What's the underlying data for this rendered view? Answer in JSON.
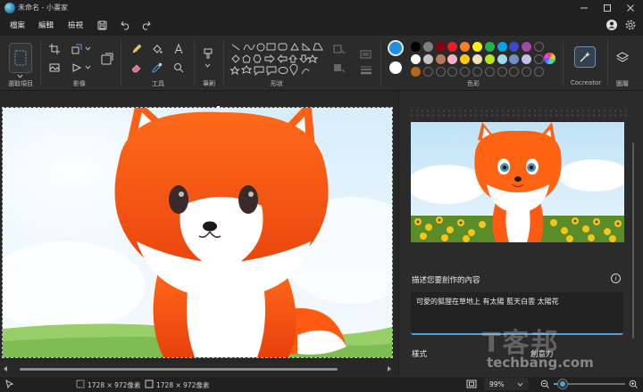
{
  "window": {
    "title": "未命名 - 小畫家",
    "minimize_icon": "minimize-icon",
    "maximize_icon": "maximize-icon",
    "close_icon": "close-icon"
  },
  "menu": {
    "file": "檔案",
    "edit": "編輯",
    "view": "檢視"
  },
  "quick_access": [
    "save-icon",
    "undo-icon",
    "redo-icon"
  ],
  "ribbon": {
    "groups": {
      "selection": "選取項目",
      "image": "影像",
      "tools": "工具",
      "brushes": "筆刷",
      "shapes": "形狀",
      "colors": "色彩",
      "cocreator": "Cocreator",
      "layers": "圖層"
    },
    "colors": {
      "primary": "#1f8fe0",
      "secondary": "#ffffff",
      "palette_row1": [
        "#000000",
        "#7f7f7f",
        "#880015",
        "#ed1c24",
        "#ff7f27",
        "#fff200",
        "#22b14c",
        "#00a2e8",
        "#3f48cc",
        "#a349a4"
      ],
      "palette_row2": [
        "#ffffff",
        "#c3c3c3",
        "#b97a57",
        "#ffaec9",
        "#ffc90e",
        "#efe4b0",
        "#b5e61d",
        "#99d9ea",
        "#7092be",
        "#c8bfe7"
      ],
      "custom_row": [
        "#b5651d"
      ]
    }
  },
  "panel": {
    "prompt_heading": "描述您要創作的內容",
    "prompt_value": "可愛的狐狸在草地上 有太陽 藍天白雲 太陽花",
    "style_label": "樣式",
    "creativity_label": "創意力"
  },
  "watermark": {
    "logo": "T客邦",
    "url": "techbang.com"
  },
  "status": {
    "canvas_size": "1728 × 972像素",
    "selection_size": "1728 × 972像素",
    "zoom": "99%",
    "zoom_level": 0.12
  }
}
